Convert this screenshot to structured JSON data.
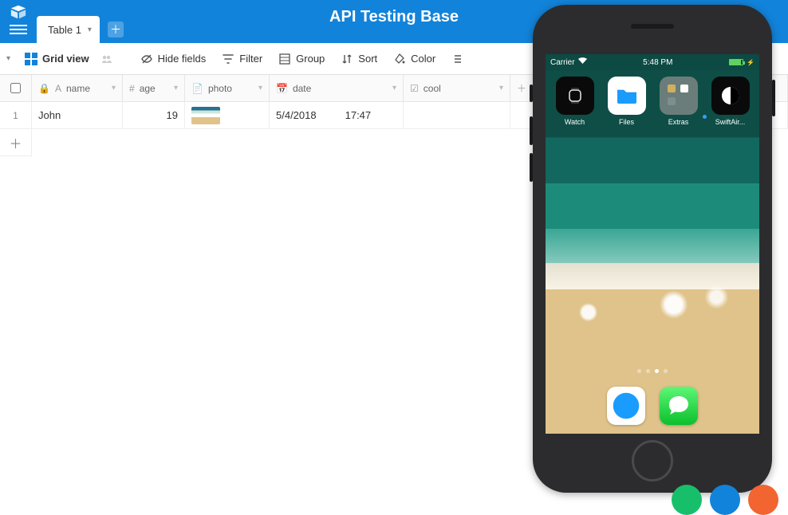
{
  "header": {
    "title": "API Testing Base",
    "tab_label": "Table 1"
  },
  "toolbar": {
    "view_label": "Grid view",
    "hide_fields": "Hide fields",
    "filter": "Filter",
    "group": "Group",
    "sort": "Sort",
    "color": "Color"
  },
  "columns": {
    "name": "name",
    "age": "age",
    "photo": "photo",
    "date": "date",
    "cool": "cool"
  },
  "row": {
    "num": "1",
    "name": "John",
    "age": "19",
    "date": "5/4/2018",
    "time": "17:47"
  },
  "phone": {
    "carrier": "Carrier",
    "time": "5:48 PM",
    "apps": {
      "watch": "Watch",
      "files": "Files",
      "extras": "Extras",
      "swift": "SwiftAir..."
    }
  }
}
